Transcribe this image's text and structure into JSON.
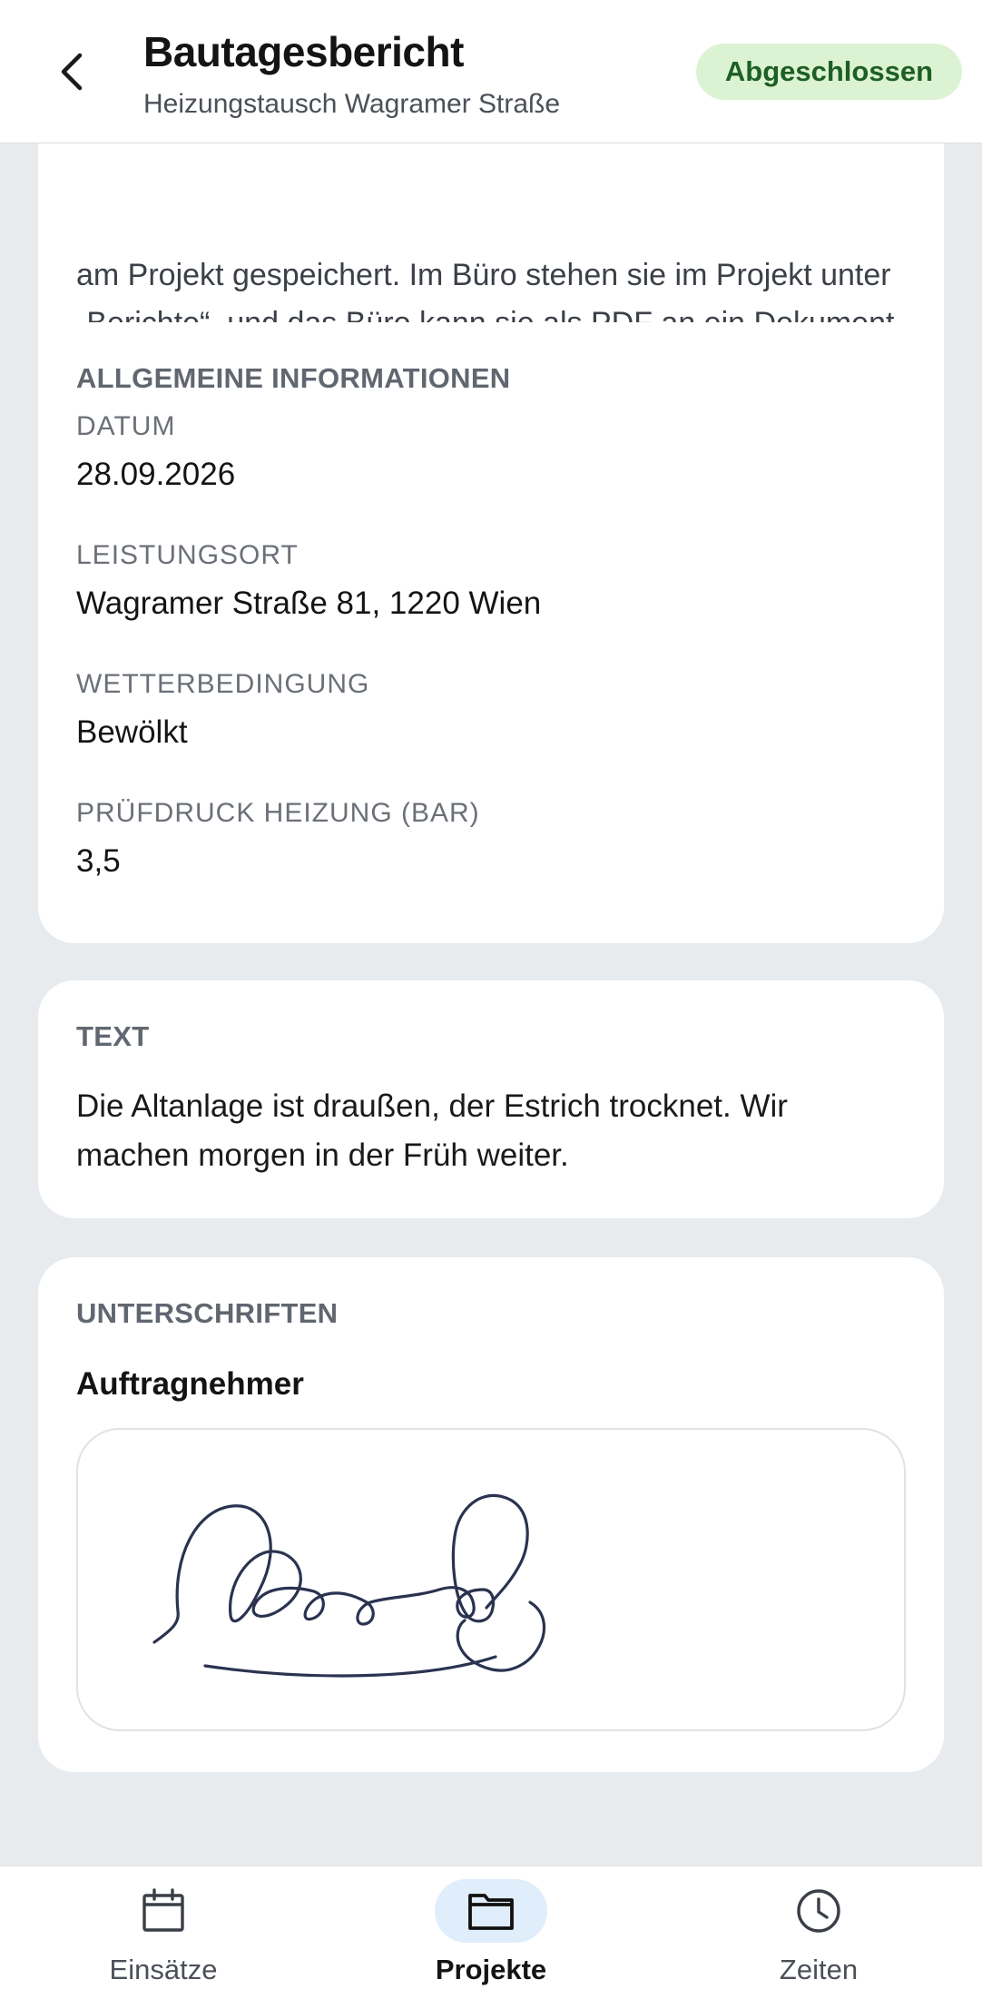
{
  "header": {
    "title": "Bautagesbericht",
    "subtitle": "Heizungstausch Wagramer Straße",
    "status": "Abgeschlossen"
  },
  "intro": {
    "text": "am Projekt gespeichert. Im Büro stehen sie im Projekt unter „Berichte“, und das Büro kann sie als PDF an ein Dokument anhängen und mit ihm verschicken."
  },
  "info": {
    "heading": "ALLGEMEINE INFORMATIONEN",
    "fields": [
      {
        "label": "DATUM",
        "value": "28.09.2026"
      },
      {
        "label": "LEISTUNGSORT",
        "value": "Wagramer Straße 81, 1220 Wien"
      },
      {
        "label": "WETTERBEDINGUNG",
        "value": "Bewölkt"
      },
      {
        "label": "PRÜFDRUCK HEIZUNG (BAR)",
        "value": "3,5"
      }
    ]
  },
  "text_section": {
    "heading": "TEXT",
    "body": "Die Altanlage ist draußen, der Estrich trocknet. Wir machen morgen in der Früh weiter."
  },
  "signatures": {
    "heading": "UNTERSCHRIFTEN",
    "signer": "Auftragnehmer"
  },
  "tabs": [
    {
      "label": "Einsätze",
      "icon": "calendar-icon",
      "active": false
    },
    {
      "label": "Projekte",
      "icon": "folder-icon",
      "active": true
    },
    {
      "label": "Zeiten",
      "icon": "clock-icon",
      "active": false
    }
  ],
  "colors": {
    "background": "#e8ebee",
    "badge_bg": "#dcf3d3",
    "badge_text": "#1d5f25",
    "active_tab_bg": "#e0edfb",
    "signature_ink": "#2a3350"
  }
}
